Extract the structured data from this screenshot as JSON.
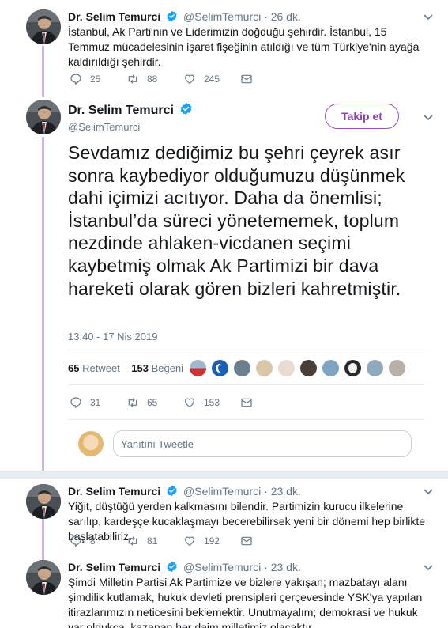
{
  "colors": {
    "accent": "#9b4dbf",
    "thread": "#cfb3e0",
    "verified": "#1da1f2",
    "muted": "#657786"
  },
  "tweet1": {
    "name": "Dr. Selim Temurci",
    "handle": "@SelimTemurci",
    "time": "· 26 dk.",
    "text": "İstanbul, Ak Parti'nin ve Liderimizin doğduğu şehirdir. İstanbul, 15 Temmuz mücadelesinin işaret fişeğinin atıldığı ve tüm Türkiye'nin ayağa kaldırıldığı şehirdir.",
    "replies": "25",
    "retweets": "88",
    "likes": "245"
  },
  "main": {
    "name": "Dr. Selim Temurci",
    "handle": "@SelimTemurci",
    "follow_label": "Takip et",
    "text": "Sevdamız dediğimiz bu şehri çeyrek asır sonra kaybediyor olduğumuzu düşünmek dahi içimizi acıtıyor. Daha da önemlisi; İstanbul’da süreci yönetememek, toplum nezdinde ahlaken-vicdanen seçimi kaybetmiş olmak Ak Partimizi bir dava hareketi olarak gören bizleri kahretmiştir.",
    "timestamp": "13:40 - 17 Nis 2019",
    "retweet_count": "65",
    "retweet_label": "Retweet",
    "like_count": "153",
    "like_label": "Beğeni",
    "replies": "31",
    "retweets": "65",
    "likes": "153"
  },
  "reply_box": {
    "placeholder": "Yanıtını Tweetle"
  },
  "tweet3": {
    "name": "Dr. Selim Temurci",
    "handle": "@SelimTemurci",
    "time": "· 23 dk.",
    "text": "Yiğit, düştüğü yerden kalkmasını bilendir. Partimizin kurucu ilkelerine sarılıp, kardeşçe kucaklaşmayı becerebilirsek yeni bir dönemi hep birlikte başlatabiliriz.",
    "replies": "8",
    "retweets": "81",
    "likes": "192"
  },
  "tweet4": {
    "name": "Dr. Selim Temurci",
    "handle": "@SelimTemurci",
    "time": "· 23 dk.",
    "text": "Şimdi Milletin Partisi Ak Partimize ve bizlere yakışan; mazbatayı alanı şimdilik kutlamak, hukuk devleti prensipleri çerçevesinde YSK'ya yapılan itirazlarımızın neticesini beklemektir. Unutmayalım; demokrasi ve hukuk var oldukça, kazanan her daim milletimiz olacaktır."
  }
}
